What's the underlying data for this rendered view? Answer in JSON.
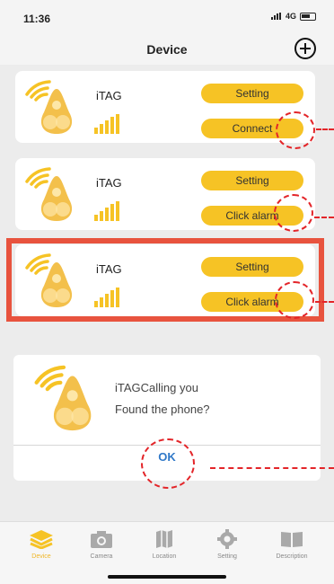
{
  "status_bar": {
    "time": "11:36",
    "network": "4G"
  },
  "nav": {
    "title": "Device",
    "add_icon": "plus-circle-icon"
  },
  "devices": [
    {
      "name": "iTAG",
      "setting_label": "Setting",
      "action_label": "Connect"
    },
    {
      "name": "iTAG",
      "setting_label": "Setting",
      "action_label": "Click alarm"
    },
    {
      "name": "iTAG",
      "setting_label": "Setting",
      "action_label": "Click alarm"
    }
  ],
  "dialog": {
    "line1": "iTAGCalling you",
    "line2": "Found the phone?",
    "ok_label": "OK"
  },
  "tabs": [
    {
      "label": "Device",
      "icon": "layers-icon",
      "active": true
    },
    {
      "label": "Camera",
      "icon": "camera-icon"
    },
    {
      "label": "Location",
      "icon": "map-icon"
    },
    {
      "label": "Setting",
      "icon": "gear-icon"
    },
    {
      "label": "Description",
      "icon": "book-icon"
    }
  ],
  "colors": {
    "accent": "#f6c325",
    "highlight": "#e8533e",
    "annotation": "#e32529",
    "link": "#2f78c8"
  }
}
